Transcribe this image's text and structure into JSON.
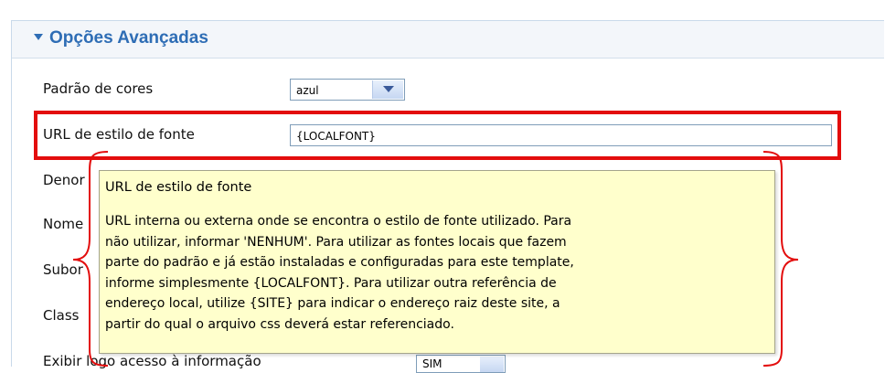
{
  "section": {
    "title": "Opções Avançadas"
  },
  "fields": {
    "color_pattern": {
      "label": "Padrão de cores",
      "value": "azul"
    },
    "font_style_url": {
      "label": "URL de estilo de fonte",
      "value": "{LOCALFONT}"
    },
    "partial_labels": [
      "Denor",
      "Nome",
      "Subor",
      "Class"
    ],
    "last_row": {
      "label": "Exibir logo acesso à informação",
      "value": "SIM"
    }
  },
  "tooltip": {
    "title": "URL de estilo de fonte",
    "body": "URL interna ou externa onde se encontra o estilo de fonte utilizado. Para\nnão utilizar, informar 'NENHUM'. Para utilizar as fontes locais que fazem\nparte do padrão e já estão instaladas e configuradas para este template,\ninforme simplesmente {LOCALFONT}. Para utilizar outra referência de\nendereço local, utilize {SITE} para indicar o endereço raiz deste site, a\npartir do qual o arquivo css deverá estar referenciado."
  },
  "annotation": {
    "highlight_color": "#e30d0d"
  },
  "colors": {
    "accent": "#2e6db5",
    "tooltip_bg": "#ffffcc"
  }
}
